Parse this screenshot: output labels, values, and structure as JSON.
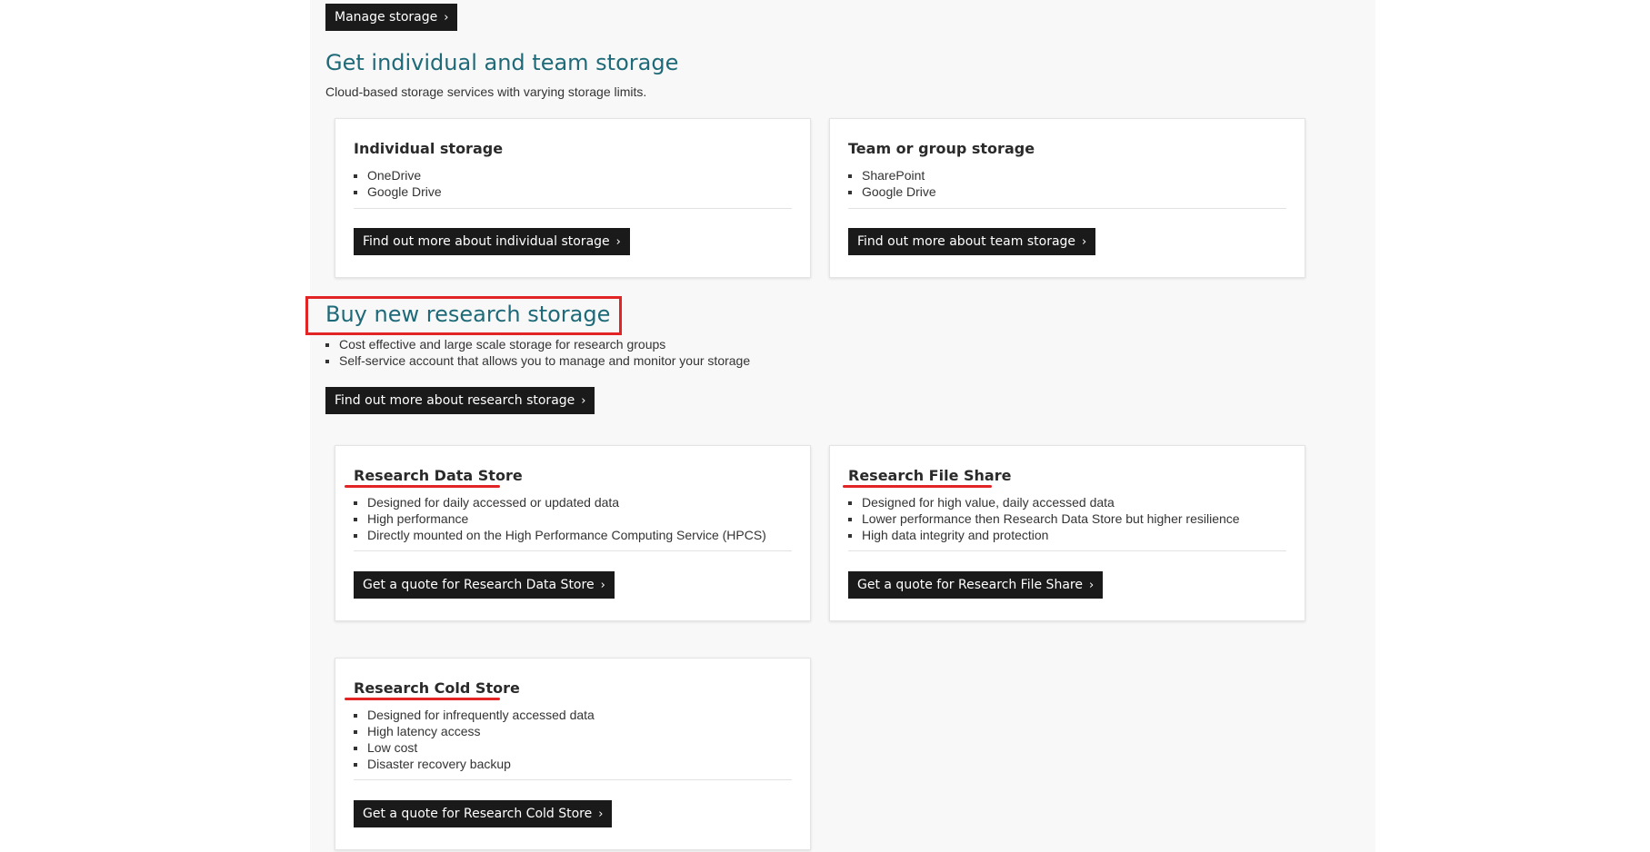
{
  "manage_button": "Manage storage",
  "individual_team": {
    "title": "Get individual and team storage",
    "subtitle": "Cloud-based storage services with varying storage limits.",
    "cards": [
      {
        "title": "Individual storage",
        "items": [
          "OneDrive",
          "Google Drive"
        ],
        "button": "Find out more about individual storage"
      },
      {
        "title": "Team or group storage",
        "items": [
          "SharePoint",
          "Google Drive"
        ],
        "button": "Find out more about team storage"
      }
    ]
  },
  "research": {
    "title": "Buy new research storage",
    "items": [
      "Cost effective and large scale storage for research groups",
      "Self-service account that allows you to manage and monitor your storage"
    ],
    "button": "Find out more about research storage",
    "cards": [
      {
        "title": "Research Data Store",
        "items": [
          "Designed for daily accessed or updated data",
          "High performance",
          "Directly mounted on the High Performance Computing Service (HPCS)"
        ],
        "button": "Get a quote for Research Data Store"
      },
      {
        "title": "Research File Share",
        "items": [
          "Designed for high value, daily accessed data",
          "Lower performance then Research Data Store but higher resilience",
          "High data integrity and protection"
        ],
        "button": "Get a quote for Research File Share"
      },
      {
        "title": "Research Cold Store",
        "items": [
          "Designed for infrequently accessed data",
          "High latency access",
          "Low cost",
          "Disaster recovery backup"
        ],
        "button": "Get a quote for Research Cold Store"
      }
    ]
  },
  "icons": {
    "chevron": "chevron-right-icon"
  },
  "chevron_glyph": "›",
  "colors": {
    "heading": "#1f6a78",
    "button_bg": "#1a1a1a",
    "annotation": "#e32424",
    "panel_bg": "#f8f8f8"
  }
}
